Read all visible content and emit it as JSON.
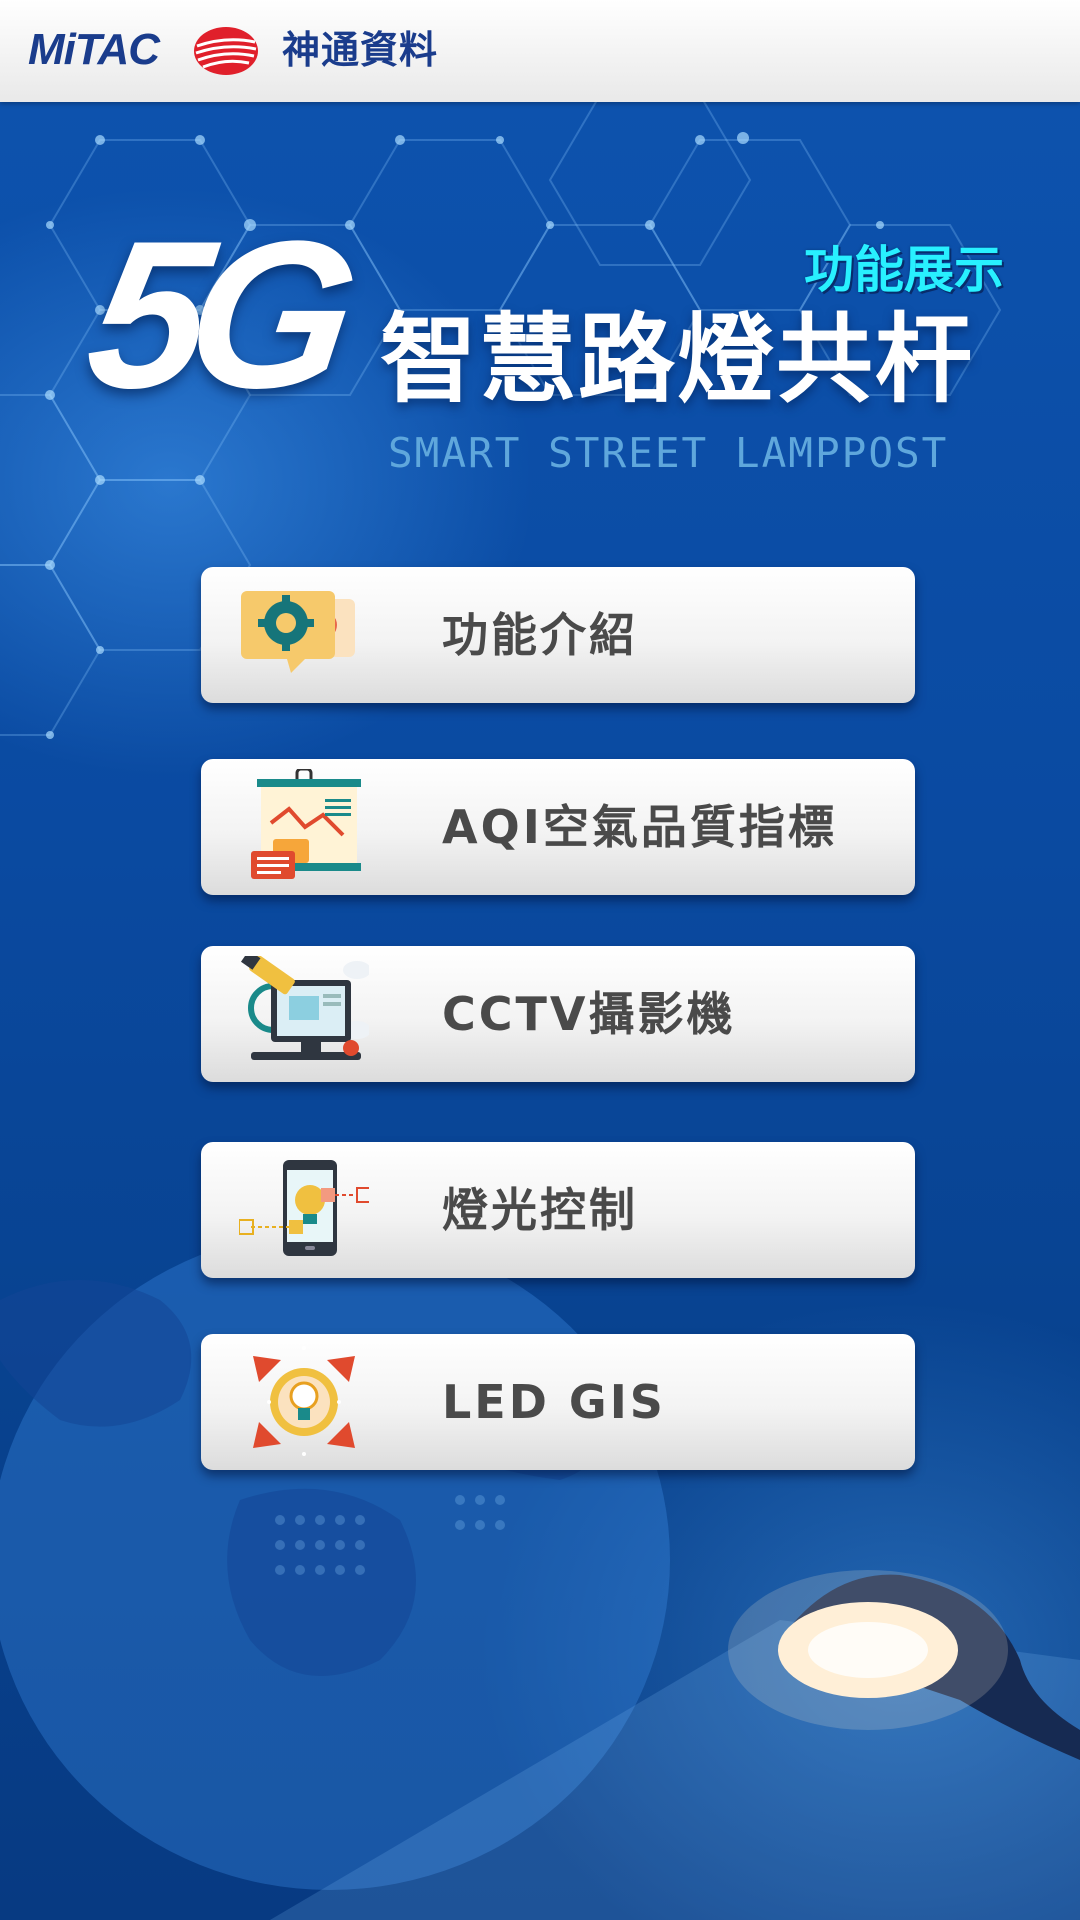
{
  "header": {
    "brand_en": "MiTAC",
    "brand_zh": "神通資料",
    "logo_icon": "mitac-globe-logo-icon"
  },
  "hero": {
    "title_5g": "5G",
    "feature_tag": "功能展示",
    "title_zh": "智慧路燈共杆",
    "title_en": "SMART STREET LAMPPOST"
  },
  "menu": {
    "items": [
      {
        "label": "功能介紹",
        "icon": "gear-chat-icon"
      },
      {
        "label": "AQI空氣品質指標",
        "icon": "chart-board-icon"
      },
      {
        "label": "CCTV攝影機",
        "icon": "cctv-monitor-icon"
      },
      {
        "label": "燈光控制",
        "icon": "phone-bulb-icon"
      },
      {
        "label": "LED GIS",
        "icon": "bulb-arrows-icon"
      }
    ]
  },
  "colors": {
    "background": "#0b4ea6",
    "header_text": "#1a3c8c",
    "accent_cyan": "#28f0ff",
    "button_text": "#4a4a4a",
    "logo_red": "#e0202b"
  }
}
